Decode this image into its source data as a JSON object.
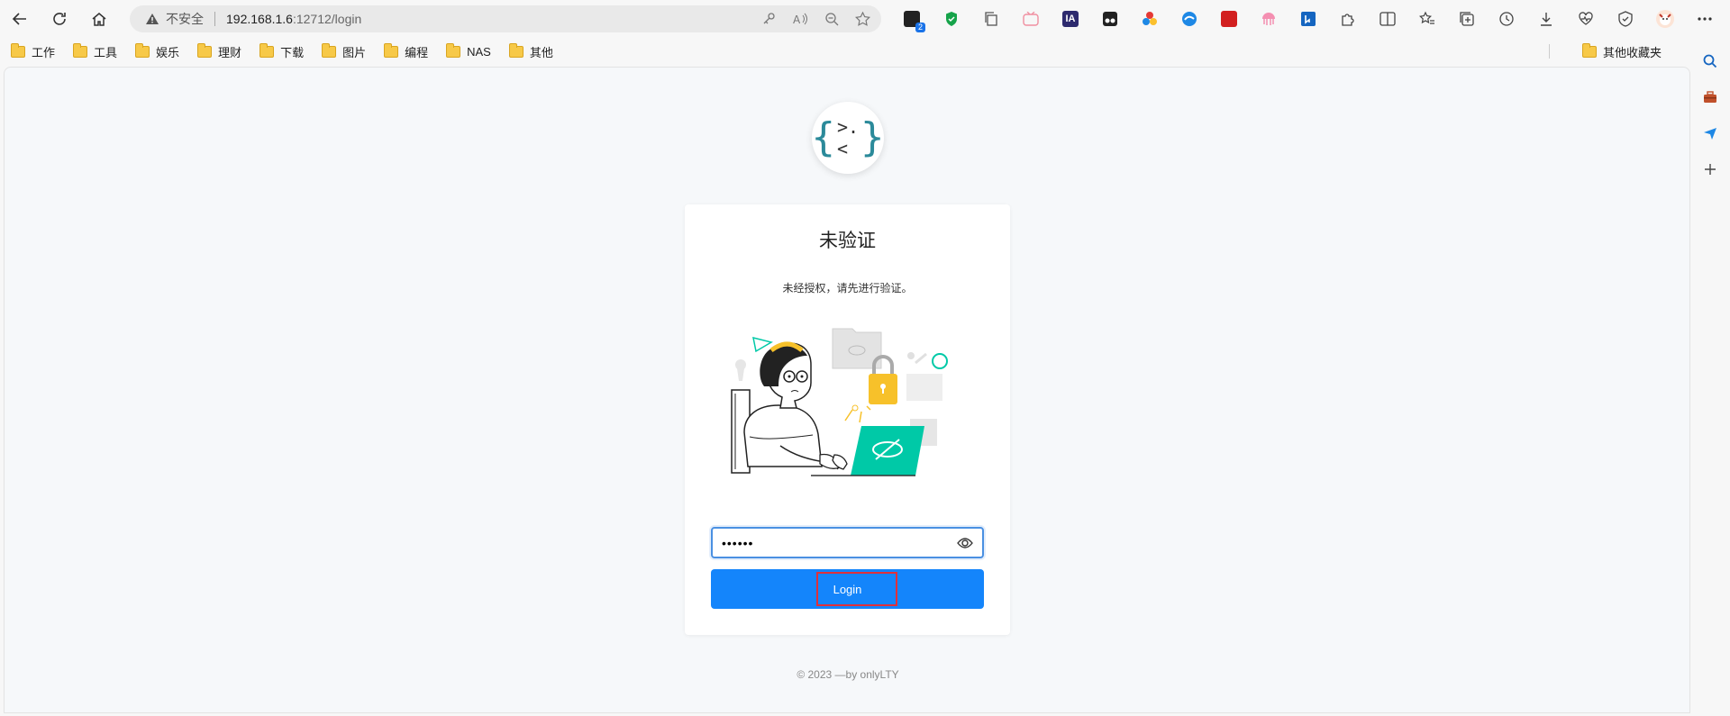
{
  "browser": {
    "address": {
      "insecure_label": "不安全",
      "host": "192.168.1.6",
      "path": ":12712/login"
    },
    "ext_badge": "2",
    "bookmarks": [
      "工作",
      "工具",
      "娱乐",
      "理财",
      "下载",
      "图片",
      "编程",
      "NAS",
      "其他"
    ],
    "other_bookmarks": "其他收藏夹"
  },
  "page": {
    "title": "未验证",
    "subtitle": "未经授权，请先进行验证。",
    "password_value": "••••••",
    "login_label": "Login",
    "footer": "© 2023 —by onlyLTY"
  },
  "colors": {
    "accent": "#1485fb",
    "highlight": "#e0303a",
    "teal": "#00c9a7",
    "yellow": "#f7c12a"
  }
}
